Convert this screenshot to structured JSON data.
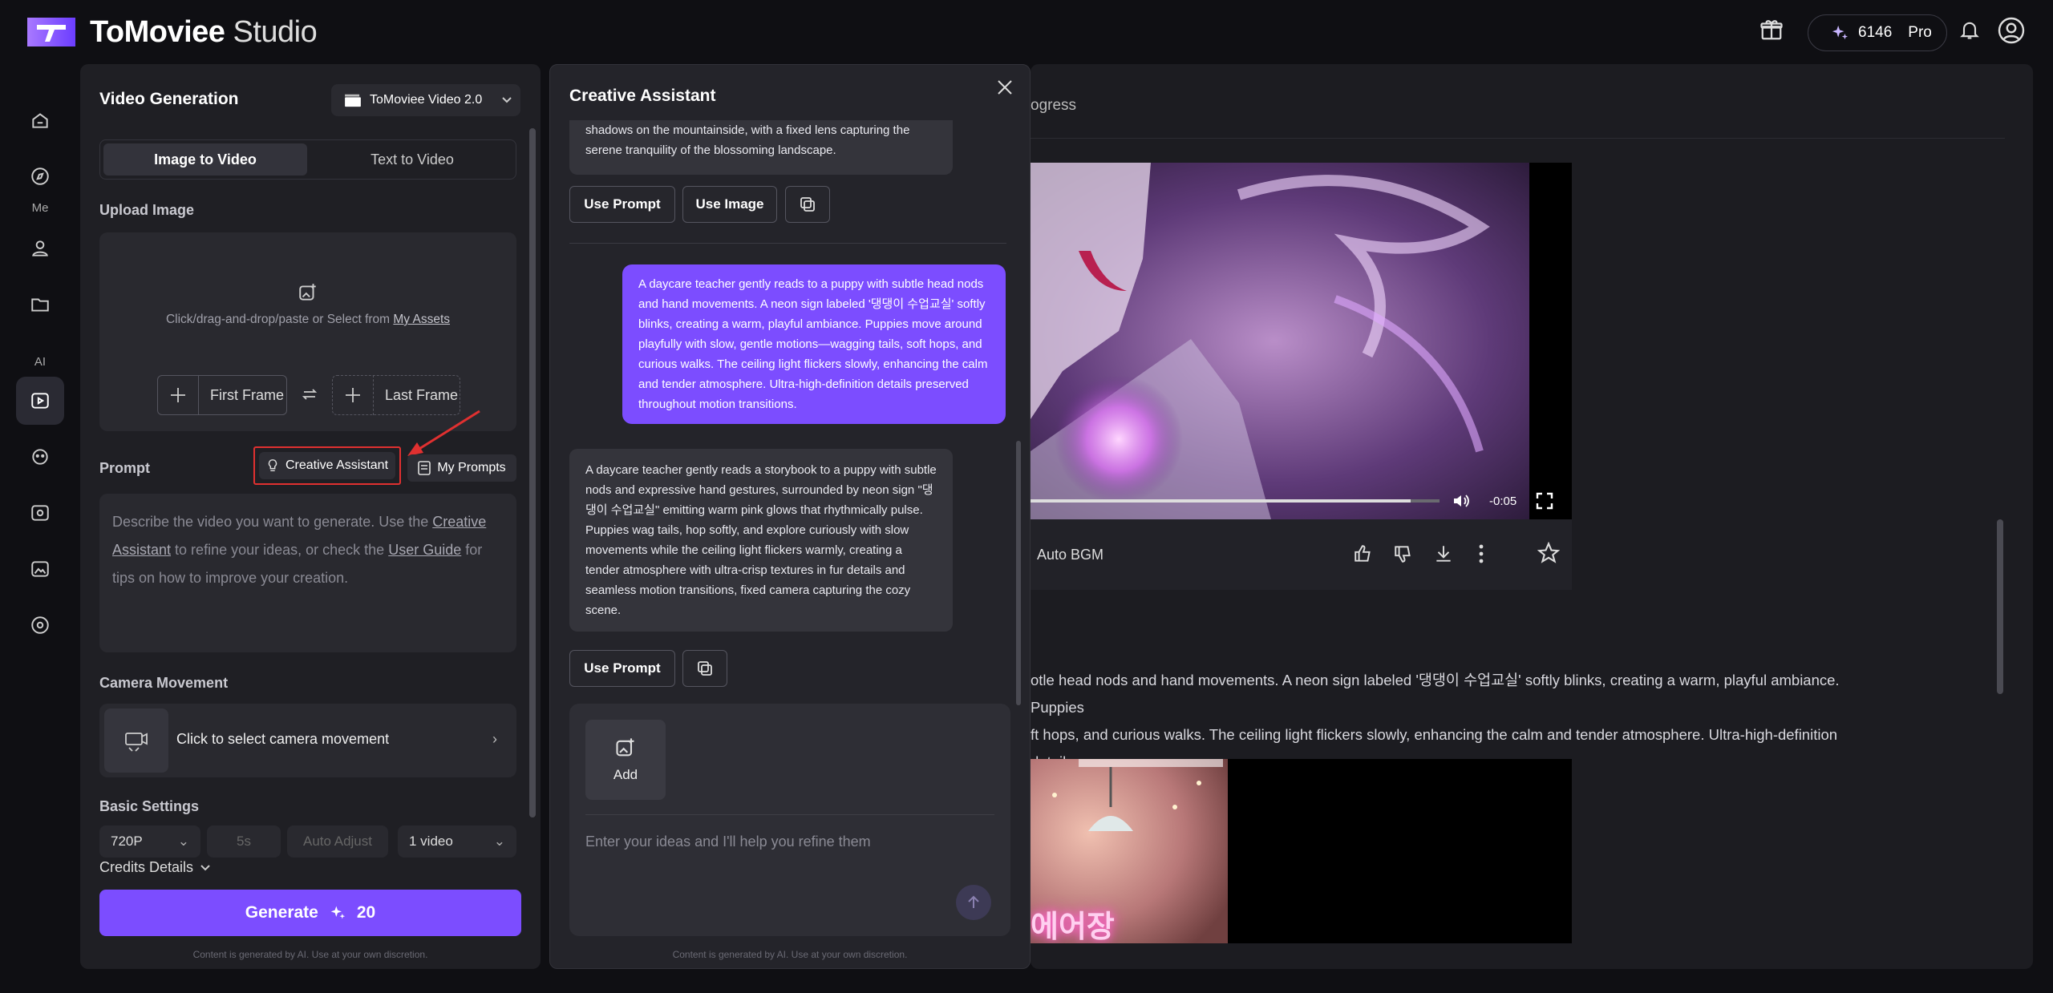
{
  "app": {
    "brand_main": "ToMoviee",
    "brand_sub": "Studio"
  },
  "header": {
    "credits": "6146",
    "plan": "Pro"
  },
  "nav": {
    "section_me": "Me",
    "section_ai": "AI"
  },
  "left_panel": {
    "title": "Video Generation",
    "model": "ToMoviee Video 2.0",
    "tabs": [
      "Image to Video",
      "Text to Video"
    ],
    "upload_label": "Upload Image",
    "upload_hint": "Click/drag-and-drop/paste or Select from",
    "upload_hint_link": "My Assets",
    "first_frame": "First Frame",
    "last_frame": "Last Frame",
    "prompt_label": "Prompt",
    "creative_assistant": "Creative Assistant",
    "my_prompts": "My Prompts",
    "prompt_ph_1": "Describe the video you want to generate. Use the",
    "prompt_ph_link1": "Creative Assistant",
    "prompt_ph_2": "to refine your ideas, or check the",
    "prompt_ph_link2": "User Guide",
    "prompt_ph_3": "for tips on how to improve your creation.",
    "camera_label": "Camera Movement",
    "camera_text": "Click to select camera movement",
    "basic_label": "Basic Settings",
    "resolution": "720P",
    "duration": "5s",
    "aspect": "Auto Adjust",
    "count": "1 video",
    "credits_details": "Credits Details",
    "generate": "Generate",
    "generate_cost": "20",
    "disclaimer": "Content is generated by AI. Use at your own discretion."
  },
  "assistant": {
    "title": "Creative Assistant",
    "msg0_tail": "shadows on the mountainside, with a fixed lens capturing the serene tranquility of the blossoming landscape.",
    "use_prompt": "Use Prompt",
    "use_image": "Use Image",
    "user_msg": "A daycare teacher gently reads to a puppy with subtle head nods and hand movements. A neon sign labeled '댕댕이 수업교실' softly blinks, creating a warm, playful ambiance. Puppies move around playfully with slow, gentle motions—wagging tails, soft hops, and curious walks. The ceiling light flickers slowly, enhancing the calm and tender atmosphere. Ultra-high-definition details preserved throughout motion transitions.",
    "reply": "A daycare teacher gently reads a storybook to a puppy with subtle nods and expressive hand gestures, surrounded by neon sign \"댕댕이 수업교실\" emitting warm pink glows that rhythmically pulse. Puppies wag tails, hop softly, and explore curiously with slow movements while the ceiling light flickers warmly, creating a tender atmosphere with ultra-crisp textures in fur details and seamless motion transitions, fixed camera capturing the cozy scene.",
    "add": "Add",
    "input_placeholder": "Enter your ideas and I'll help you refine them",
    "disclaimer": "Content is generated by AI. Use at your own discretion."
  },
  "main": {
    "progress_text": "ogress",
    "time_remaining": "-0:05",
    "bgm": "Auto BGM",
    "description_line1": "otle head nods and hand movements. A neon sign labeled '댕댕이 수업교실' softly blinks, creating a warm, playful ambiance. Puppies",
    "description_line2": "ft hops, and curious walks. The ceiling light flickers slowly, enhancing the calm and tender atmosphere. Ultra-high-definition details",
    "neon_partial": "에어장",
    "video_progress": 0.93
  },
  "colors": {
    "accent": "#7c4dff",
    "highlight": "#e03030"
  }
}
